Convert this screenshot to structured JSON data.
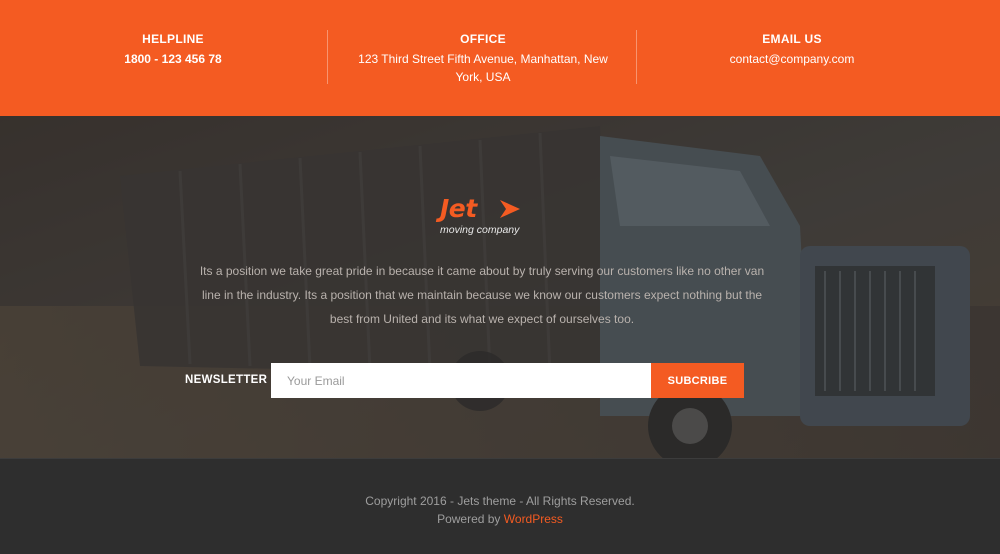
{
  "contact": {
    "helpline": {
      "label": "HELPLINE",
      "value": "1800 - 123 456 78"
    },
    "office": {
      "label": "OFFICE",
      "value_line1": "123 Third Street Fifth Avenue, Manhattan, New",
      "value_line2": "York, USA"
    },
    "email": {
      "label": "EMAIL US",
      "value": "contact@company.com"
    }
  },
  "logo": {
    "name": "Jet",
    "tagline": "moving company",
    "icon": "chevron-arrow-icon"
  },
  "about": {
    "line1": "Its a position we take great pride in because it came about by truly serving our customers like no other van",
    "line2": "line in the industry. Its a position that we maintain because we know our customers expect nothing but the",
    "line3": "best from United and its what we expect of ourselves too."
  },
  "newsletter": {
    "label": "NEWSLETTER",
    "placeholder": "Your Email",
    "button": "SUBCRIBE"
  },
  "footer": {
    "copyright": "Copyright 2016 - Jets theme - All Rights Reserved.",
    "powered_prefix": "Powered by",
    "powered_link": "WordPress"
  },
  "colors": {
    "accent": "#f45b22",
    "footer_bg": "#2e2e2e",
    "hero_overlay": "#282625"
  }
}
